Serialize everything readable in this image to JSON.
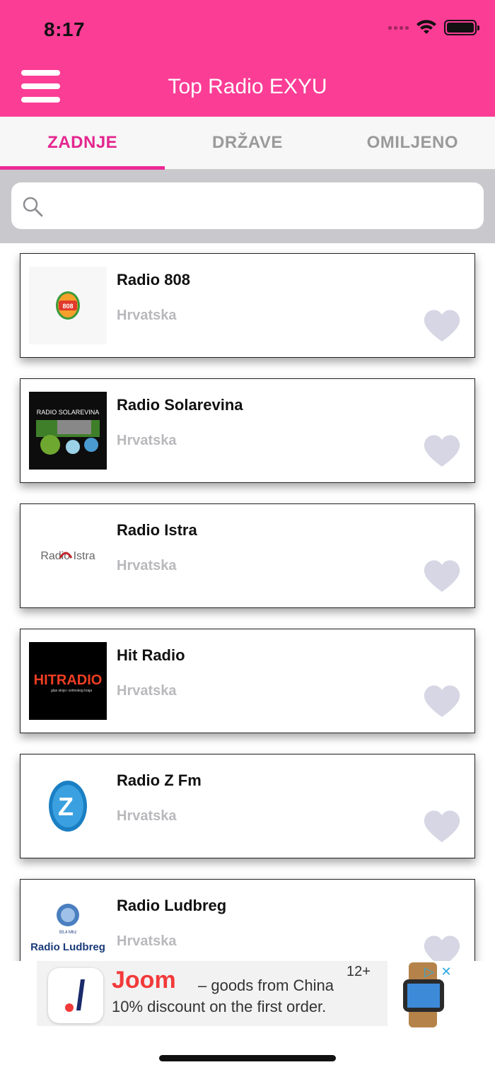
{
  "status_bar": {
    "time": "8:17"
  },
  "header": {
    "title": "Top Radio EXYU"
  },
  "tabs": [
    {
      "label": "ZADNJE",
      "active": true
    },
    {
      "label": "DRŽAVE",
      "active": false
    },
    {
      "label": "OMILJENO",
      "active": false
    }
  ],
  "search": {
    "placeholder": ""
  },
  "stations": [
    {
      "name": "Radio 808",
      "country": "Hrvatska",
      "logo_text": "808"
    },
    {
      "name": "Radio Solarevina",
      "country": "Hrvatska",
      "logo_text": "RADIO SOLAREVINA"
    },
    {
      "name": "Radio Istra",
      "country": "Hrvatska",
      "logo_text": "Radio Istra"
    },
    {
      "name": "Hit Radio",
      "country": "Hrvatska",
      "logo_text": "HITRADIO",
      "logo_subtext": "glas sinja i cetinskog kraja"
    },
    {
      "name": "Radio Z Fm",
      "country": "Hrvatska",
      "logo_text": "Z"
    },
    {
      "name": "Radio Ludbreg",
      "country": "Hrvatska",
      "logo_text": "Radio Ludbreg",
      "logo_subtext": "93,4 Mhz"
    }
  ],
  "ad": {
    "brand": "Joom",
    "tagline": "– goods from China",
    "age_rating": "12+",
    "discount": "10% discount on the first order."
  },
  "colors": {
    "header": "#fb3d96",
    "active_tab": "#e4268f",
    "heart": "#d6d6e4",
    "country_text": "#b9b9bd"
  }
}
